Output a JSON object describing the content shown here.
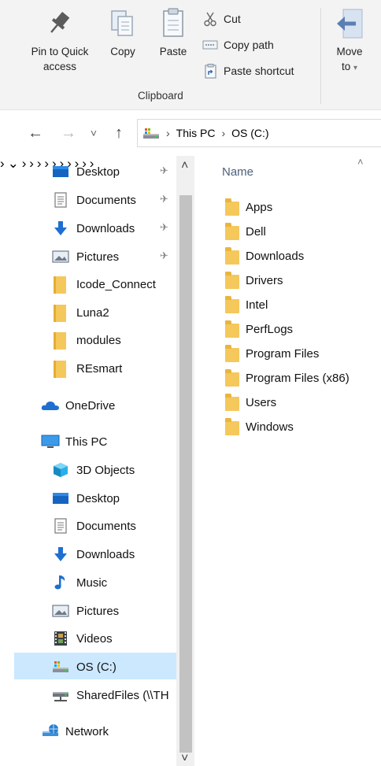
{
  "ribbon": {
    "pin_label_1": "Pin to Quick",
    "pin_label_2": "access",
    "copy_label": "Copy",
    "paste_label": "Paste",
    "cut_label": "Cut",
    "copy_path_label": "Copy path",
    "paste_shortcut_label": "Paste shortcut",
    "move_label_1": "Move",
    "move_label_2": "to",
    "move_caret": "▾",
    "clipboard_group": "Clipboard"
  },
  "address": {
    "back": "←",
    "forward": "→",
    "recent": "˅",
    "up": "↑",
    "crumbs": [
      "This PC",
      "OS (C:)"
    ],
    "sep": "›"
  },
  "nav": {
    "quick_access": [
      {
        "label": "Desktop",
        "icon": "desktop-icon",
        "pinned": true
      },
      {
        "label": "Documents",
        "icon": "documents-icon",
        "pinned": true
      },
      {
        "label": "Downloads",
        "icon": "downloads-icon",
        "pinned": true
      },
      {
        "label": "Pictures",
        "icon": "pictures-icon",
        "pinned": true
      },
      {
        "label": "Icode_Connect",
        "icon": "folder-icon",
        "pinned": false
      },
      {
        "label": "Luna2",
        "icon": "folder-icon",
        "pinned": false
      },
      {
        "label": "modules",
        "icon": "folder-icon",
        "pinned": false
      },
      {
        "label": "REsmart",
        "icon": "folder-icon",
        "pinned": false
      }
    ],
    "onedrive": "OneDrive",
    "this_pc": "This PC",
    "this_pc_children": [
      {
        "label": "3D Objects",
        "icon": "3d-objects-icon"
      },
      {
        "label": "Desktop",
        "icon": "desktop-icon"
      },
      {
        "label": "Documents",
        "icon": "documents-icon"
      },
      {
        "label": "Downloads",
        "icon": "downloads-icon"
      },
      {
        "label": "Music",
        "icon": "music-icon"
      },
      {
        "label": "Pictures",
        "icon": "pictures-icon"
      },
      {
        "label": "Videos",
        "icon": "videos-icon"
      },
      {
        "label": "OS (C:)",
        "icon": "drive-icon",
        "selected": true
      },
      {
        "label": "SharedFiles (\\\\TH",
        "icon": "network-drive-icon"
      }
    ],
    "network": "Network",
    "pin_glyph": "✈",
    "chevron_right": "›",
    "chevron_down": "⌄",
    "scroll_up": "˄",
    "scroll_down": "˅"
  },
  "content": {
    "column_name": "Name",
    "sort_caret": "˄",
    "files": [
      "Apps",
      "Dell",
      "Downloads",
      "Drivers",
      "Intel",
      "PerfLogs",
      "Program Files",
      "Program Files (x86)",
      "Users",
      "Windows"
    ]
  },
  "colors": {
    "selected_bg": "#cce8ff",
    "folder_yellow": "#f5c85c",
    "header_text": "#4c607a"
  }
}
